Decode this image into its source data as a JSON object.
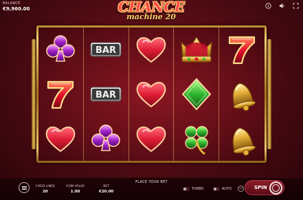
{
  "header": {
    "balance_label": "BALANCE",
    "balance_value": "€9,960.00",
    "logo_line1": "CHANCE",
    "logo_line2": "machine 20"
  },
  "reels": [
    [
      "club",
      "seven",
      "heart"
    ],
    [
      "bar",
      "bar",
      "club"
    ],
    [
      "heart",
      "heart",
      "heart"
    ],
    [
      "crown",
      "diamond",
      "clover"
    ],
    [
      "seven",
      "bell",
      "bell"
    ]
  ],
  "symbols": {
    "bar_text": "BAR"
  },
  "footer": {
    "place_bet": "PLACE YOUR BET",
    "fixed_lines_label": "FIXED LINES",
    "fixed_lines_value": "20",
    "coin_value_label": "COIN VALUE",
    "coin_value_value": "1.00",
    "bet_label": "BET",
    "bet_value": "€20.00",
    "turbo_label": "TURBO",
    "auto_label": "AUTO",
    "minus_label": "−",
    "spin_label": "SPIN"
  },
  "colors": {
    "background": "#5a0c15",
    "frame_gold": "#e9c56b",
    "heart_red": "#e01e36",
    "club_purple": "#a020c8",
    "diamond_green": "#2fb52f",
    "spin_button": "#8c1d2a"
  }
}
